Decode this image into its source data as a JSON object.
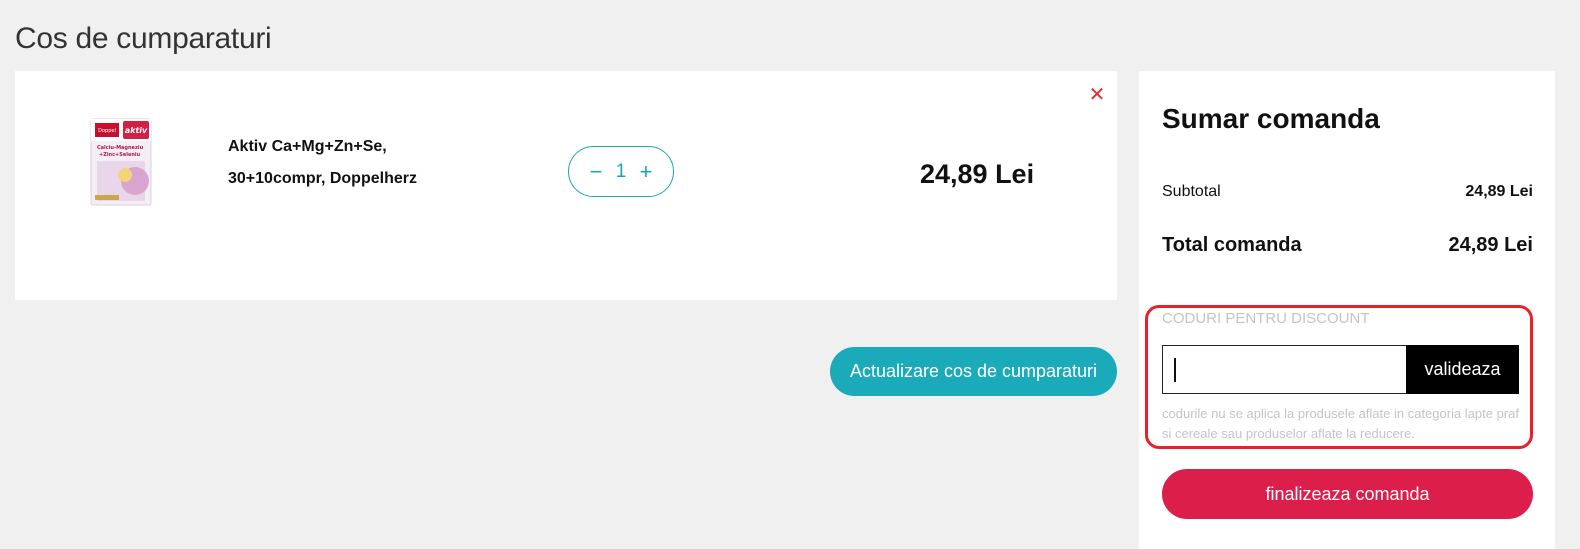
{
  "page": {
    "title": "Cos de cumparaturi"
  },
  "cart": {
    "items": [
      {
        "name_line1": "Aktiv Ca+Mg+Zn+Se,",
        "name_line2": "30+10compr, Doppelherz",
        "quantity": "1",
        "price": "24,89 Lei",
        "image_brand": "Doppel herz",
        "image_tag": "aktiv"
      }
    ],
    "update_button": "Actualizare cos de cumparaturi"
  },
  "summary": {
    "title": "Sumar comanda",
    "subtotal_label": "Subtotal",
    "subtotal_value": "24,89 Lei",
    "total_label": "Total comanda",
    "total_value": "24,89 Lei",
    "discount_label": "CODURI PENTRU DISCOUNT",
    "discount_input_value": "",
    "validate_button": "valideaza",
    "discount_note": "codurile nu se aplica la produsele aflate in categoria lapte praf si cereale sau produselor aflate la reducere.",
    "checkout_button": "finalizeaza comanda"
  },
  "icons": {
    "remove": "close-icon",
    "decrement": "minus-icon",
    "increment": "plus-icon"
  },
  "colors": {
    "accent_teal": "#1aaab9",
    "checkout_red": "#dc1e4b",
    "highlight_red": "#e8202a",
    "remove_red": "#e03030"
  }
}
